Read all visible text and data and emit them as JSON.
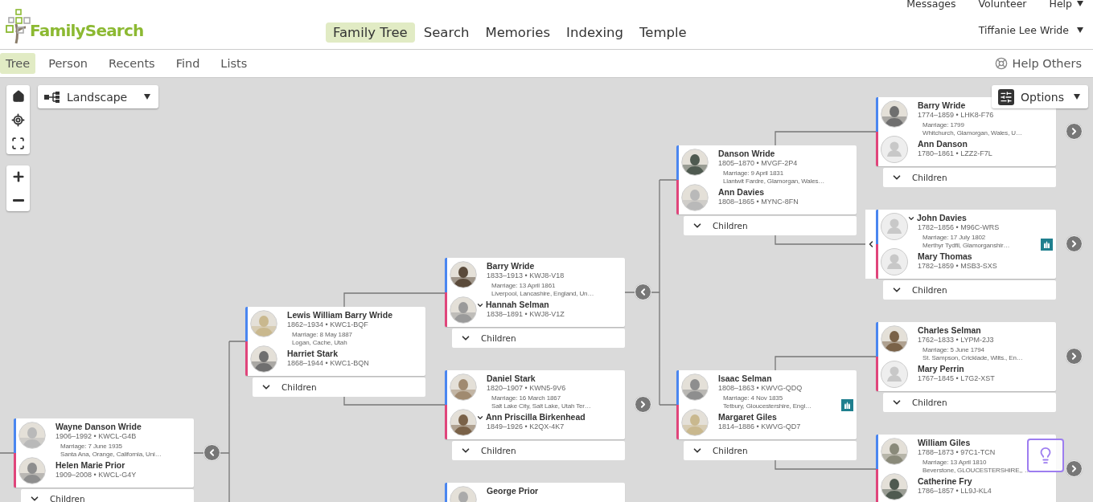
{
  "header": {
    "brand": "FamilySearch",
    "top_links": [
      {
        "label": "Messages",
        "caret": false
      },
      {
        "label": "Volunteer",
        "caret": false
      },
      {
        "label": "Help",
        "caret": true
      }
    ],
    "nav": [
      {
        "label": "Family Tree",
        "selected": true
      },
      {
        "label": "Search",
        "selected": false
      },
      {
        "label": "Memories",
        "selected": false
      },
      {
        "label": "Indexing",
        "selected": false
      },
      {
        "label": "Temple",
        "selected": false
      }
    ],
    "user": "Tiffanie Lee Wride"
  },
  "subnav": {
    "items": [
      {
        "label": "Tree",
        "selected": true
      },
      {
        "label": "Person",
        "selected": false
      },
      {
        "label": "Recents",
        "selected": false
      },
      {
        "label": "Find",
        "selected": false
      },
      {
        "label": "Lists",
        "selected": false
      }
    ],
    "help": "Help Others"
  },
  "view_select": "Landscape",
  "options": "Options",
  "couples": [
    {
      "father": {
        "name": "Wayne Danson Wride",
        "dates": "1906–1992 • KWCL-G4B",
        "photo": true,
        "menu": false
      },
      "marriage": "Marriage: 7 June 1935",
      "place": "Santa Ana, Orange, California, Uni…",
      "mother": {
        "name": "Helen Marie Prior",
        "dates": "1909–2008 • KWCL-G4Y",
        "photo": true,
        "menu": false
      },
      "children": "Children",
      "collapse": true,
      "expand": false,
      "temple": false,
      "back": false
    },
    {
      "father": {
        "name": "Lewis William Barry Wride",
        "dates": "1862–1934 • KWC1-BQF",
        "photo": true,
        "menu": false
      },
      "marriage": "Marriage: 8 May 1887",
      "place": "Logan, Cache, Utah",
      "mother": {
        "name": "Harriet Stark",
        "dates": "1868–1944 • KWC1-BQN",
        "photo": true,
        "menu": false
      },
      "children": "Children",
      "collapse": false,
      "expand": false,
      "temple": false,
      "back": false
    },
    {
      "father": {
        "name": "Barry Wride",
        "dates": "1833–1913 • KWJ8-V18",
        "photo": true,
        "menu": false
      },
      "marriage": "Marriage: 13 April 1861",
      "place": "Liverpool, Lancashire, England, Un…",
      "mother": {
        "name": "Hannah Selman",
        "dates": "1838–1891 • KWJ8-V1Z",
        "photo": true,
        "menu": true
      },
      "children": "Children",
      "collapse": true,
      "expand": false,
      "temple": false,
      "back": false
    },
    {
      "father": {
        "name": "Daniel Stark",
        "dates": "1820–1907 • KWN5-9V6",
        "photo": true,
        "menu": false
      },
      "marriage": "Marriage: 16 March 1867",
      "place": "Salt Lake City, Salt Lake, Utah Ter…",
      "mother": {
        "name": "Ann Priscilla Birkenhead",
        "dates": "1849–1926 • K2QX-4K7",
        "photo": true,
        "menu": true
      },
      "children": "Children",
      "collapse": false,
      "expand": true,
      "temple": false,
      "back": false
    },
    {
      "father": {
        "name": "George Prior",
        "photo": true,
        "menu": false
      },
      "collapse": false,
      "expand": false,
      "temple": false,
      "back": false
    },
    {
      "father": {
        "name": "Danson Wride",
        "dates": "1805–1870 • MVGF-2P4",
        "photo": true,
        "menu": false
      },
      "marriage": "Marriage: 9 April 1831",
      "place": "Llantwit Fardre, Glamorgan, Wales…",
      "mother": {
        "name": "Ann Davies",
        "dates": "1808–1865 • MYNC-8FN",
        "photo": true,
        "menu": false
      },
      "children": "Children",
      "collapse": false,
      "expand": false,
      "temple": false,
      "back": false
    },
    {
      "father": {
        "name": "Isaac Selman",
        "dates": "1808–1863 • KWVG-QDQ",
        "photo": true,
        "menu": false
      },
      "marriage": "Marriage: 4 Nov 1835",
      "place": "Tetbury, Gloucestershire, Engl…",
      "mother": {
        "name": "Margaret Giles",
        "dates": "1814–1886 • KWVG-QD7",
        "photo": true,
        "menu": false
      },
      "children": "Children",
      "collapse": false,
      "expand": false,
      "temple": true,
      "back": false
    },
    {
      "father": {
        "name": "Barry Wride",
        "dates": "1774–1859 • LHK8-F76",
        "photo": true,
        "menu": false
      },
      "marriage": "Marriage: 1799",
      "place": "Whitchurch, Glamorgan, Wales, U…",
      "mother": {
        "name": "Ann Danson",
        "dates": "1780–1861 • LZZ2-F7L",
        "photo": false,
        "menu": false
      },
      "children": "Children",
      "collapse": false,
      "expand": true,
      "temple": false,
      "back": false
    },
    {
      "father": {
        "name": "John Davies",
        "dates": "1782–1856 • M96C-WRS",
        "photo": false,
        "menu": true
      },
      "marriage": "Marriage: 17 July 1802",
      "place": "Merthyr Tydfil, Glamorganshir…",
      "mother": {
        "name": "Mary Thomas",
        "dates": "1782–1859 • MSB3-SXS",
        "photo": false,
        "menu": false
      },
      "children": "Children",
      "collapse": false,
      "expand": true,
      "temple": true,
      "back": true
    },
    {
      "father": {
        "name": "Charles Selman",
        "dates": "1762–1833 • LYPM-2J3",
        "photo": true,
        "menu": false
      },
      "marriage": "Marriage: 5 June 1794",
      "place": "St. Sampson, Cricklade, Wilts., En…",
      "mother": {
        "name": "Mary Perrin",
        "dates": "1767–1845 • L7G2-XST",
        "photo": false,
        "menu": false
      },
      "children": "Children",
      "collapse": false,
      "expand": true,
      "temple": false,
      "back": false
    },
    {
      "father": {
        "name": "William Giles",
        "dates": "1788–1873 • 97C1-TCN",
        "photo": true,
        "menu": false
      },
      "marriage": "Marriage: 13 April 1810",
      "place": "Beverstone, GLOUCESTERSHIRE,, …",
      "mother": {
        "name": "Catherine Fry",
        "dates": "1786–1857 • LL9J-KL4",
        "photo": true,
        "menu": false
      },
      "collapse": false,
      "expand": true,
      "temple": false,
      "back": false
    }
  ]
}
